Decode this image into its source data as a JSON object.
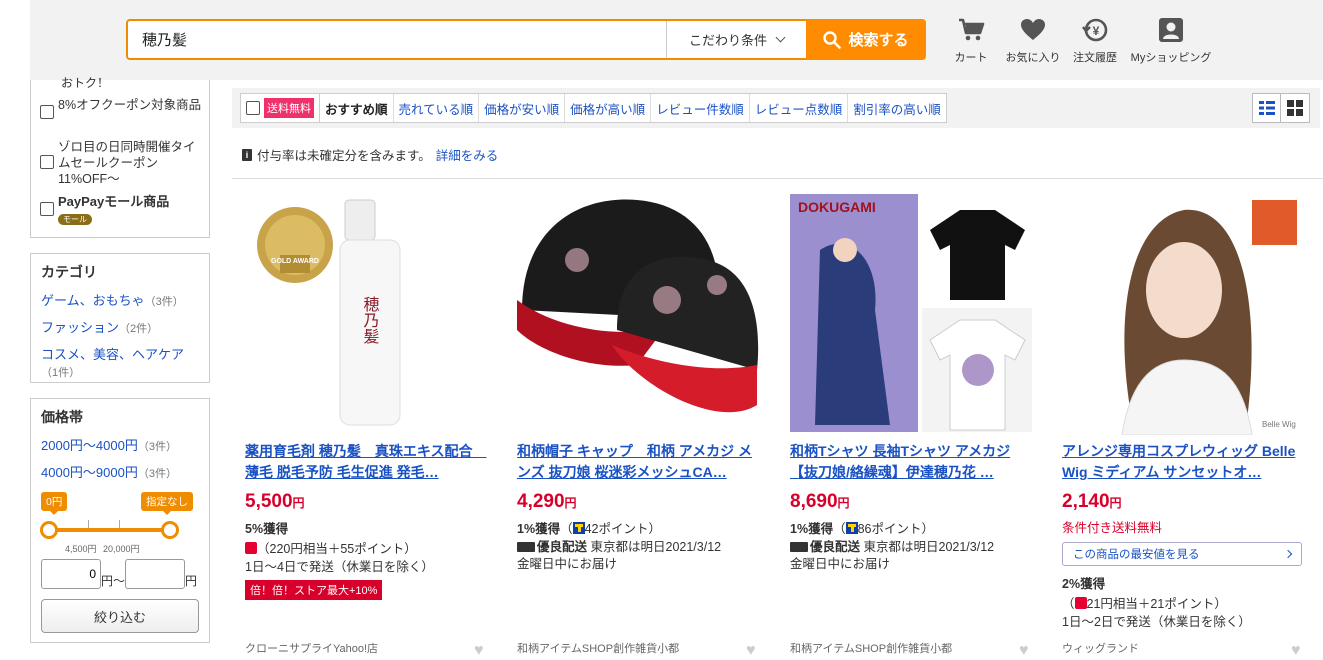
{
  "search": {
    "value": "穂乃髪",
    "kodawari": "こだわり条件",
    "button": "検索する"
  },
  "header_icons": [
    {
      "icon": "cart-icon",
      "label": "カート"
    },
    {
      "icon": "heart-icon",
      "label": "お気に入り"
    },
    {
      "icon": "history-icon",
      "label": "注文履歴"
    },
    {
      "icon": "user-icon",
      "label": "Myショッピング"
    }
  ],
  "sidebar": {
    "cut_text": "おトク！",
    "filters": [
      {
        "label": "8%オフクーポン対象商品"
      },
      {
        "label": "ゾロ目の日同時開催タイムセールクーポン 11%OFF〜"
      },
      {
        "label": "PayPayモール商品",
        "badge": "モール"
      }
    ],
    "category": {
      "title": "カテゴリ",
      "items": [
        {
          "label": "ゲーム、おもちゃ",
          "count": "（3件）"
        },
        {
          "label": "ファッション",
          "count": "（2件）"
        },
        {
          "label": "コスメ、美容、ヘアケア",
          "count": "（1件）"
        }
      ]
    },
    "price": {
      "title": "価格帯",
      "ranges": [
        {
          "label": "2000円〜4000円",
          "count": "（3件）"
        },
        {
          "label": "4000円〜9000円",
          "count": "（3件）"
        }
      ],
      "min_tag": "0円",
      "max_tag": "指定なし",
      "tick1": "4,500円",
      "tick2": "20,000円",
      "min_value": "0",
      "unit1": "円〜",
      "unit2": "円",
      "submit": "絞り込む"
    }
  },
  "toolbar": {
    "free_ship": "送料無料",
    "sorts": [
      "おすすめ順",
      "売れている順",
      "価格が安い順",
      "価格が高い順",
      "レビュー件数順",
      "レビュー点数順",
      "割引率の高い順"
    ]
  },
  "notice": {
    "text": "付与率は未確定分を含みます。",
    "link": "詳細をみる"
  },
  "products": [
    {
      "title": "薬用育毛剤 穂乃髪　真珠エキス配合　薄毛 脱毛予防 毛生促進 発毛…",
      "price": "5,500",
      "yen": "円",
      "points_main": "5%獲得",
      "points_detail": "（220円相当＋55ポイント）",
      "shipping": "1日〜4日で発送（休業日を除く）",
      "promo": "倍！倍！ストア最大+10%",
      "image_text": "穂乃髪",
      "award": "GOLD AWARD",
      "store": "クローニサプライYahoo!店"
    },
    {
      "title": "和柄帽子 キャップ　和柄 アメカジ メンズ 抜刀娘 桜迷彩メッシュCA…",
      "price": "4,290",
      "yen": "円",
      "points_main": "1%獲得",
      "points_detail": "42ポイント",
      "delivery_label": "優良配送",
      "delivery_text": "東京都は明日2021/3/12",
      "delivery_text2": "金曜日中にお届け",
      "store": "和柄アイテムSHOP創作雑貨小都"
    },
    {
      "title": "和柄Tシャツ 長袖Tシャツ アメカジ【抜刀娘/絡繰魂】伊達穂乃花 …",
      "price": "8,690",
      "yen": "円",
      "points_main": "1%獲得",
      "points_detail": "86ポイント",
      "delivery_label": "優良配送",
      "delivery_text": "東京都は明日2021/3/12",
      "delivery_text2": "金曜日中にお届け",
      "image_text": "DOKUGAMI",
      "store": "和柄アイテムSHOP創作雑貨小都"
    },
    {
      "title": "アレンジ専用コスプレウィッグ Belle Wig ミディアム サンセットオ…",
      "price": "2,140",
      "yen": "円",
      "conditional_shipping": "条件付き送料無料",
      "lowest_price": "この商品の最安値を見る",
      "points_main": "2%獲得",
      "points_detail": "21円相当＋21ポイント",
      "shipping": "1日〜2日で発送（休業日を除く）",
      "image_text": "Belle Wig",
      "store": "ウィッグランド"
    }
  ],
  "colors": {
    "accent": "#ff8c00",
    "price": "#d8002a",
    "link": "#1a52c4"
  }
}
